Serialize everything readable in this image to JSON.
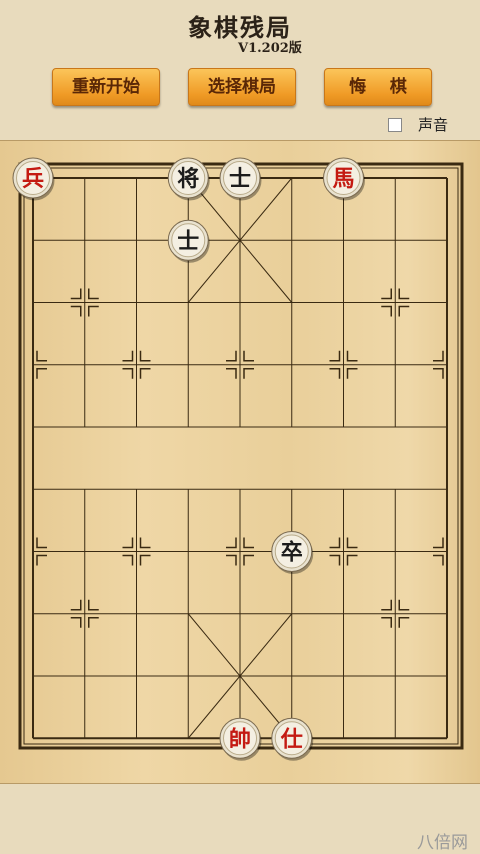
{
  "app": {
    "title": "象棋残局",
    "version": "V1.202版"
  },
  "toolbar": {
    "restart_label": "重新开始",
    "select_label": "选择棋局",
    "undo_label": "悔    棋"
  },
  "options": {
    "sound_label": "声音",
    "sound_checked": false
  },
  "board": {
    "files": 9,
    "ranks": 10,
    "pieces": [
      {
        "char": "兵",
        "side": "red",
        "file": 0,
        "rank": 0
      },
      {
        "char": "将",
        "side": "black",
        "file": 3,
        "rank": 0
      },
      {
        "char": "士",
        "side": "black",
        "file": 4,
        "rank": 0
      },
      {
        "char": "馬",
        "side": "red",
        "file": 6,
        "rank": 0
      },
      {
        "char": "士",
        "side": "black",
        "file": 3,
        "rank": 1
      },
      {
        "char": "卒",
        "side": "black",
        "file": 5,
        "rank": 6
      },
      {
        "char": "帥",
        "side": "red",
        "file": 4,
        "rank": 9
      },
      {
        "char": "仕",
        "side": "red",
        "file": 5,
        "rank": 9
      }
    ]
  },
  "colors": {
    "red_piece": "#c41a12",
    "black_piece": "#1c1c1c",
    "line": "#3a2a12"
  },
  "watermark": "八倍网"
}
